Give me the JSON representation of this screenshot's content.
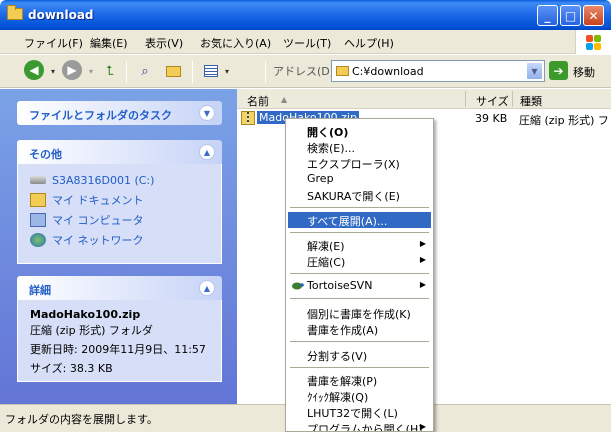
{
  "window": {
    "title": "download"
  },
  "menubar": {
    "items": [
      "ファイル(F)",
      "編集(E)",
      "表示(V)",
      "お気に入り(A)",
      "ツール(T)",
      "ヘルプ(H)"
    ]
  },
  "toolbar": {
    "address_label": "アドレス(D)",
    "address_value": "C:¥download",
    "go_label": "移動"
  },
  "taskpane": {
    "file_tasks": {
      "title": "ファイルとフォルダのタスク"
    },
    "other": {
      "title": "その他",
      "items": [
        "S3A8316D001 (C:)",
        "マイ ドキュメント",
        "マイ コンピュータ",
        "マイ ネットワーク"
      ]
    },
    "details": {
      "title": "詳細",
      "name": "MadoHako100.zip",
      "type": "圧縮 (zip 形式) フォルダ",
      "modified": "更新日時: 2009年11月9日、11:57",
      "size": "サイズ: 38.3 KB"
    }
  },
  "filelist": {
    "columns": [
      "名前",
      "サイズ",
      "種類"
    ],
    "rows": [
      {
        "name": "MadoHako100.zip",
        "size": "39 KB",
        "type": "圧縮 (zip 形式) フ"
      }
    ]
  },
  "context_menu": {
    "items": [
      {
        "label": "開く(O)",
        "bold": true
      },
      {
        "label": "検索(E)..."
      },
      {
        "label": "エクスプローラ(X)"
      },
      {
        "label": "Grep"
      },
      {
        "label": "SAKURAで開く(E)"
      },
      {
        "label": "すべて展開(A)...",
        "highlighted": true
      },
      {
        "label": "解凍(E)",
        "submenu": true
      },
      {
        "label": "圧縮(C)",
        "submenu": true
      },
      {
        "label": "TortoiseSVN",
        "submenu": true
      },
      {
        "label": "個別に書庫を作成(K)"
      },
      {
        "label": "書庫を作成(A)"
      },
      {
        "label": "分割する(V)"
      },
      {
        "label": "書庫を解凍(P)"
      },
      {
        "label": "ｸｲｯｸ解凍(Q)"
      },
      {
        "label": "LHUT32で開く(L)"
      },
      {
        "label": "プログラムから開く(H)",
        "submenu": true
      }
    ]
  },
  "statusbar": {
    "text": "フォルダの内容を展開します。"
  },
  "colors": {
    "title_blue": "#0052d6",
    "selection": "#316ac5",
    "task_link": "#215dc6"
  }
}
